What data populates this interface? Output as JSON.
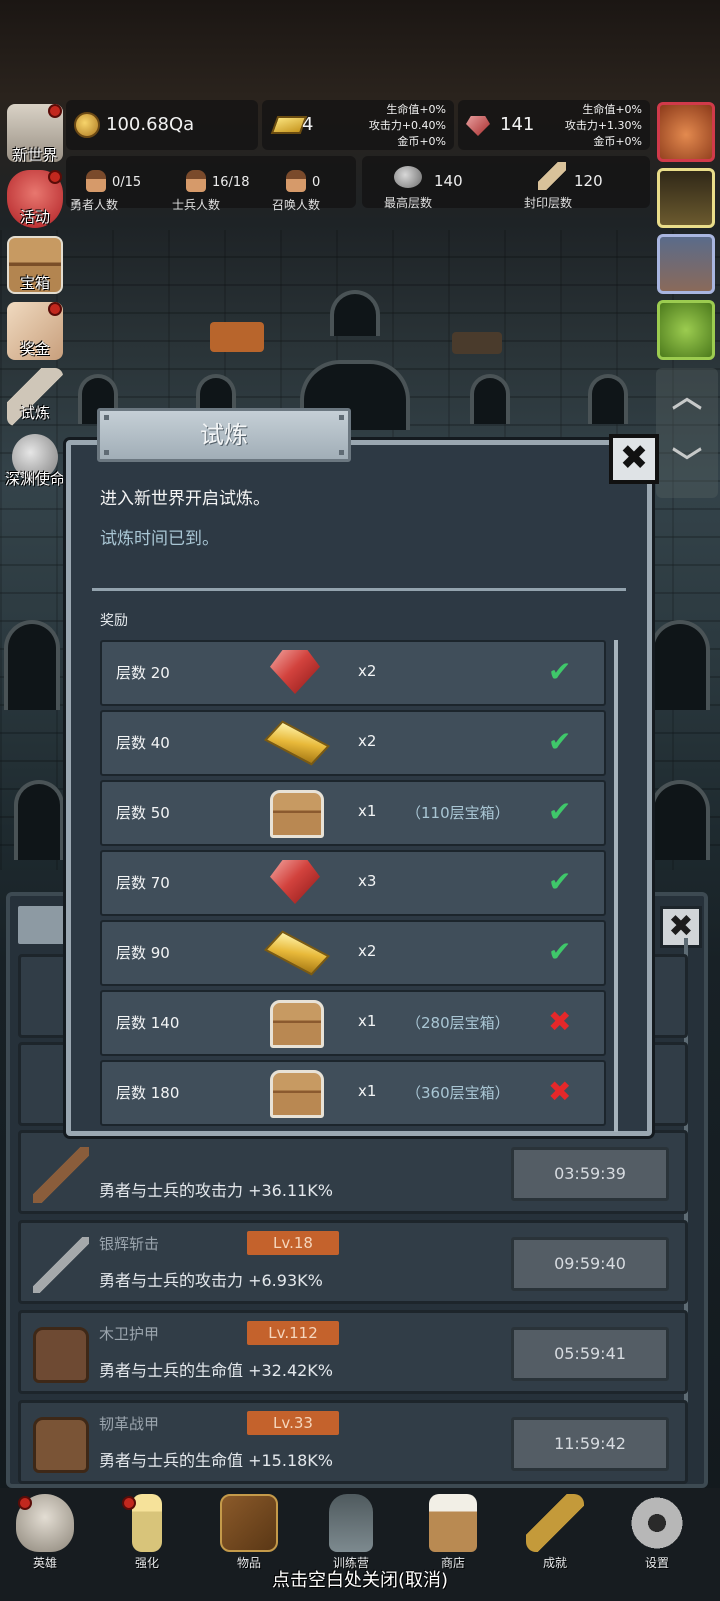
{
  "resources": {
    "coins": "100.68Qa",
    "gold": "4",
    "gold_bonus": [
      "生命值+0%",
      "攻击力+0.40%",
      "金币+0%"
    ],
    "gems": "141",
    "gems_bonus": [
      "生命值+0%",
      "攻击力+1.30%",
      "金币+0%"
    ]
  },
  "counts": {
    "heroes": {
      "value": "0/15",
      "label": "勇者人数"
    },
    "soldiers": {
      "value": "16/18",
      "label": "士兵人数"
    },
    "summons": {
      "value": "0",
      "label": "召唤人数"
    },
    "max_floor": {
      "value": "140",
      "label": "最高层数"
    },
    "sealed_floor": {
      "value": "120",
      "label": "封印层数"
    }
  },
  "left_menu": [
    {
      "label": "新世界",
      "icon": "castle-icon"
    },
    {
      "label": "活动",
      "icon": "heart-icon"
    },
    {
      "label": "宝箱",
      "icon": "chest-icon"
    },
    {
      "label": "奖金",
      "icon": "envelope-icon"
    },
    {
      "label": "试炼",
      "icon": "feather-icon"
    },
    {
      "label": "深渊使命",
      "icon": "orb-icon"
    }
  ],
  "modal": {
    "title": "试炼",
    "line1": "进入新世界开启试炼。",
    "line2": "试炼时间已到。",
    "rewards_label": "奖励",
    "close_icon": "✖",
    "rewards": [
      {
        "floor": "层数 20",
        "item": "gem",
        "qty": "x2",
        "note": "",
        "claimed": true
      },
      {
        "floor": "层数 40",
        "item": "gold-bar",
        "qty": "x2",
        "note": "",
        "claimed": true
      },
      {
        "floor": "层数 50",
        "item": "chest",
        "qty": "x1",
        "note": "（110层宝箱）",
        "claimed": true
      },
      {
        "floor": "层数 70",
        "item": "gem",
        "qty": "x3",
        "note": "",
        "claimed": true
      },
      {
        "floor": "层数 90",
        "item": "gold-bar",
        "qty": "x2",
        "note": "",
        "claimed": true
      },
      {
        "floor": "层数 140",
        "item": "chest",
        "qty": "x1",
        "note": "（280层宝箱）",
        "claimed": false
      },
      {
        "floor": "层数 180",
        "item": "chest",
        "qty": "x1",
        "note": "（360层宝箱）",
        "claimed": false
      }
    ]
  },
  "upgrades": [
    {
      "name": "",
      "level": "",
      "desc": "勇者与士兵的攻击力 +36.11K%",
      "timer": "03:59:39"
    },
    {
      "name": "银辉斩击",
      "level": "Lv.18",
      "desc": "勇者与士兵的攻击力 +6.93K%",
      "timer": "09:59:40"
    },
    {
      "name": "木卫护甲",
      "level": "Lv.112",
      "desc": "勇者与士兵的生命值 +32.42K%",
      "timer": "05:59:41"
    },
    {
      "name": "韧革战甲",
      "level": "Lv.33",
      "desc": "勇者与士兵的生命值 +15.18K%",
      "timer": "11:59:42"
    }
  ],
  "bottom_nav": [
    {
      "label": "英雄",
      "icon": "skull-icon"
    },
    {
      "label": "强化",
      "icon": "candle-icon"
    },
    {
      "label": "物品",
      "icon": "book-icon"
    },
    {
      "label": "训练营",
      "icon": "lantern-icon"
    },
    {
      "label": "商店",
      "icon": "mug-icon"
    },
    {
      "label": "成就",
      "icon": "key-icon"
    },
    {
      "label": "设置",
      "icon": "gear-icon"
    }
  ],
  "hint": "点击空白处关闭(取消)",
  "colors": {
    "claimed": "#3fc86a",
    "unclaimed": "#e5282a",
    "level_badge": "#c4622c",
    "panel": "#2d3944"
  }
}
